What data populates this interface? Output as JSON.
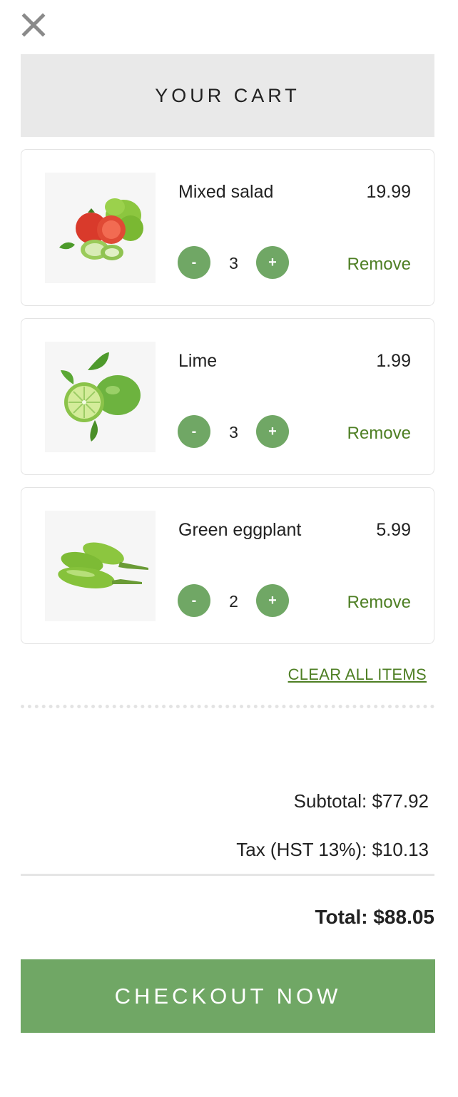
{
  "header": {
    "close_icon": "close-icon",
    "title": "YOUR CART",
    "background": "#e9e9e9"
  },
  "items": [
    {
      "name": "Mixed salad",
      "price": "19.99",
      "quantity": "3",
      "minus_label": "-",
      "plus_label": "+",
      "remove_label": "Remove",
      "image_icon": "mixed-salad-image"
    },
    {
      "name": "Lime",
      "price": "1.99",
      "quantity": "3",
      "minus_label": "-",
      "plus_label": "+",
      "remove_label": "Remove",
      "image_icon": "lime-image"
    },
    {
      "name": "Green eggplant",
      "price": "5.99",
      "quantity": "2",
      "minus_label": "-",
      "plus_label": "+",
      "remove_label": "Remove",
      "image_icon": "green-eggplant-image"
    }
  ],
  "clear_all_label": "CLEAR ALL ITEMS",
  "summary": {
    "subtotal": "Subtotal: $77.92",
    "tax": "Tax (HST 13%): $10.13",
    "total": "Total: $88.05"
  },
  "checkout_label": "CHECKOUT NOW",
  "colors": {
    "accent_green": "#70a765",
    "link_green": "#4e7f24",
    "text": "#222222",
    "border": "#e3e3e3"
  }
}
